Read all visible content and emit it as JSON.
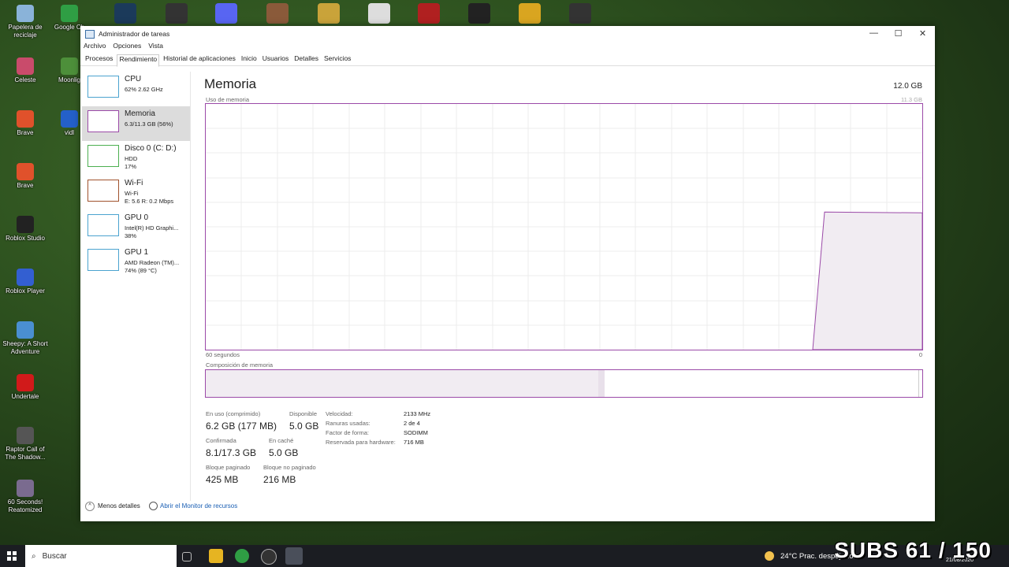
{
  "desktop": {
    "left_icons": [
      {
        "label": "Papelera de reciclaje",
        "color": "#8ab3d9"
      },
      {
        "label": "Celeste",
        "color": "#c94b6b"
      },
      {
        "label": "Brave",
        "color": "#e0512b"
      },
      {
        "label": "Brave",
        "color": "#e0512b"
      },
      {
        "label": "Roblox Studio",
        "color": "#222"
      },
      {
        "label": "Roblox Player",
        "color": "#335fd1"
      },
      {
        "label": "Sheepy: A Short Adventure",
        "color": "#4a8fd1"
      },
      {
        "label": "Undertale",
        "color": "#d11a1a"
      },
      {
        "label": "Raptor Call of The Shadow...",
        "color": "#555"
      },
      {
        "label": "60 Seconds! Reatomized",
        "color": "#7a6b8f"
      }
    ],
    "col2_icons": [
      {
        "label": "Google Ch",
        "color": "#2f9e44"
      },
      {
        "label": "Moonlig",
        "color": "#4d8f3a"
      },
      {
        "label": "vidl",
        "color": "#2460c9"
      }
    ]
  },
  "window": {
    "title": "Administrador de tareas",
    "menu": [
      "Archivo",
      "Opciones",
      "Vista"
    ],
    "tabs": [
      "Procesos",
      "Rendimiento",
      "Historial de aplicaciones",
      "Inicio",
      "Usuarios",
      "Detalles",
      "Servicios"
    ],
    "active_tab": "Rendimiento"
  },
  "sidebar": [
    {
      "name": "CPU",
      "line1": "62% 2.62 GHz",
      "line2": "",
      "color": "#4ba3cf"
    },
    {
      "name": "Memoria",
      "line1": "6.3/11.3 GB (56%)",
      "line2": "",
      "color": "#9b4aa8"
    },
    {
      "name": "Disco 0 (C: D:)",
      "line1": "HDD",
      "line2": "17%",
      "color": "#4caf50"
    },
    {
      "name": "Wi-Fi",
      "line1": "Wi-Fi",
      "line2": "E: 5.6 R: 0.2 Mbps",
      "color": "#a0522d"
    },
    {
      "name": "GPU 0",
      "line1": "Intel(R) HD Graphi...",
      "line2": "38%",
      "color": "#4ba3cf"
    },
    {
      "name": "GPU 1",
      "line1": "AMD Radeon (TM)...",
      "line2": "74% (89 °C)",
      "color": "#4ba3cf"
    }
  ],
  "memory": {
    "title": "Memoria",
    "max": "12.0 GB",
    "graph_label": "Uso de memoria",
    "graph_top_right": "11.3 GB",
    "time_left": "60 segundos",
    "time_right": "0",
    "composition_label": "Composición de memoria",
    "usage_fraction": 0.56,
    "stats": {
      "in_use_label": "En uso (comprimido)",
      "in_use": "6.2 GB (177 MB)",
      "available_label": "Disponible",
      "available": "5.0 GB",
      "committed_label": "Confirmada",
      "committed": "8.1/17.3 GB",
      "cached_label": "En caché",
      "cached": "5.0 GB",
      "paged_label": "Bloque paginado",
      "paged": "425 MB",
      "nonpaged_label": "Bloque no paginado",
      "nonpaged": "216 MB"
    },
    "details": [
      {
        "k": "Velocidad:",
        "v": "2133 MHz"
      },
      {
        "k": "Ranuras usadas:",
        "v": "2 de 4"
      },
      {
        "k": "Factor de forma:",
        "v": "SODIMM"
      },
      {
        "k": "Reservada para hardware:",
        "v": "716 MB"
      }
    ]
  },
  "footer": {
    "less": "Menos detalles",
    "monitor": "Abrir el Monitor de recursos"
  },
  "taskbar": {
    "search": "Buscar",
    "weather": "24°C  Prac. despejado",
    "date": "21/08/2020"
  },
  "overlay": {
    "subs": "SUBS 61 / 150"
  }
}
